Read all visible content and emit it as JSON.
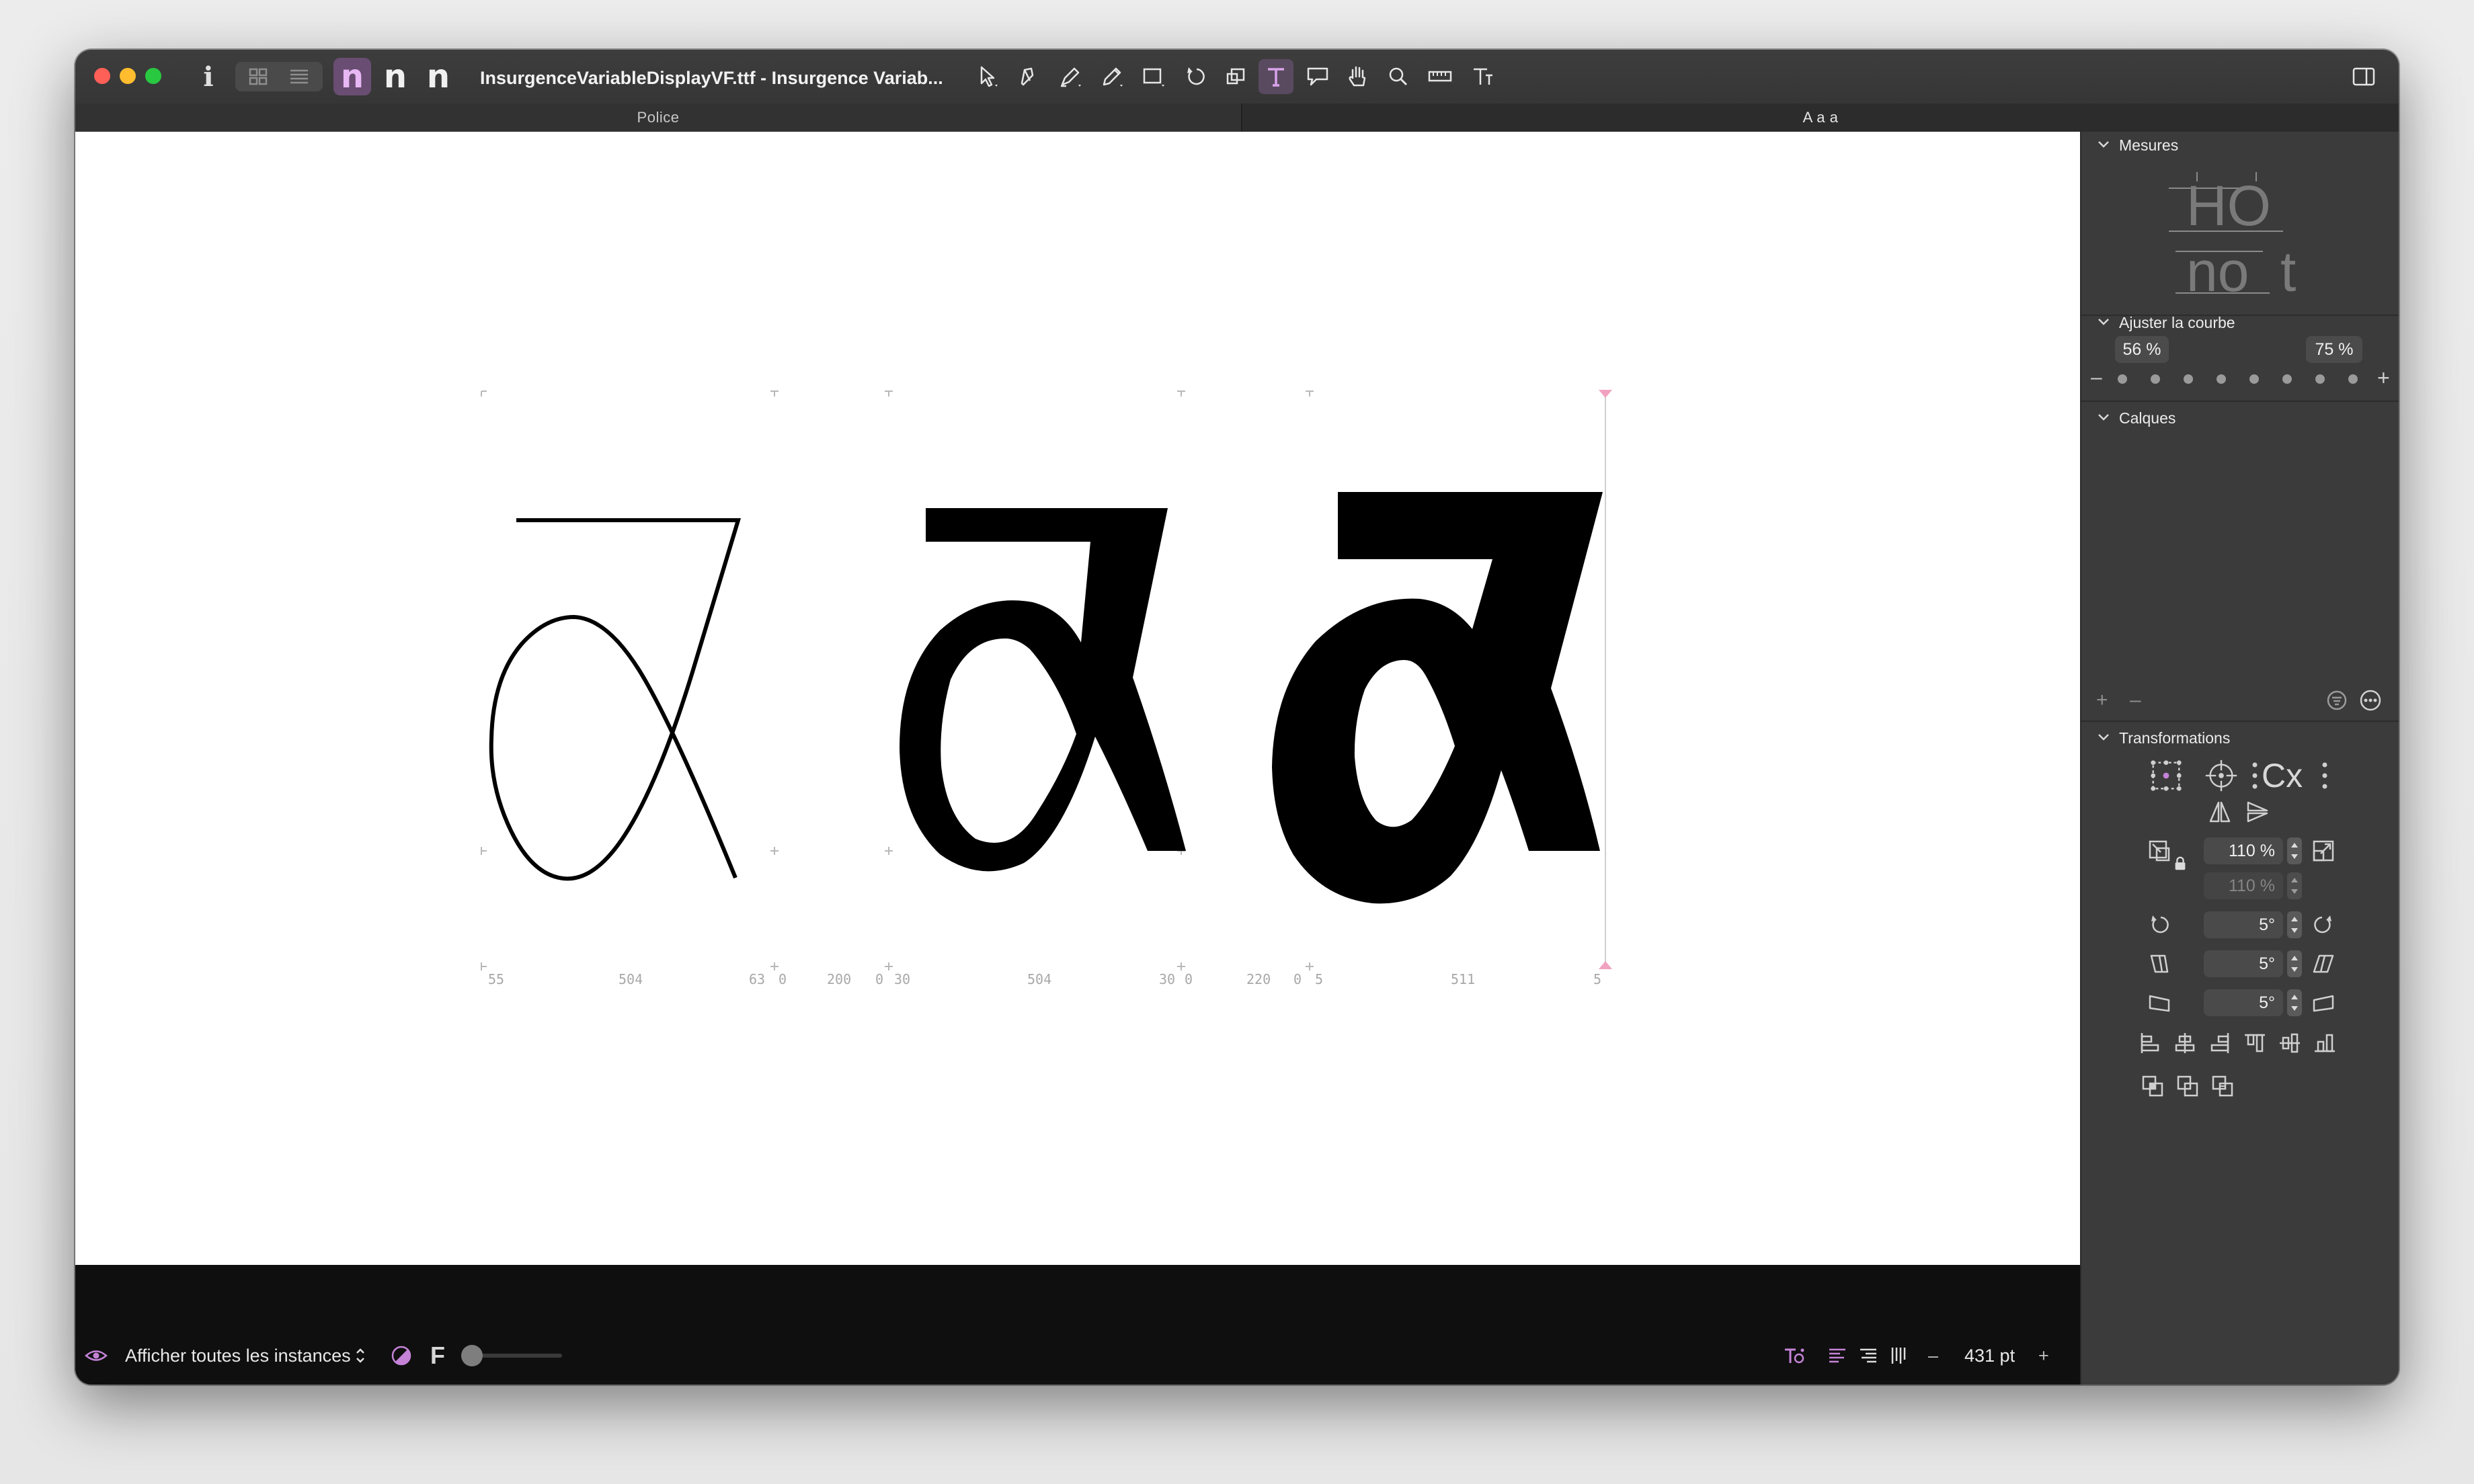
{
  "window": {
    "title": "InsurgenceVariableDisplayVF.ttf - Insurgence Variab...",
    "glyph_tabs": [
      "n",
      "n",
      "n"
    ]
  },
  "tabs": {
    "left": "Police",
    "right": "A a a"
  },
  "canvas": {
    "metrics": [
      "55",
      "504",
      "63",
      "0",
      "200",
      "0",
      "30",
      "504",
      "30",
      "0",
      "220",
      "0",
      "5",
      "511",
      "5"
    ],
    "glyph_char": "α"
  },
  "statusbar": {
    "instances_label": "Afficher toutes les instances",
    "font_glyph": "F",
    "zoom": "431 pt",
    "zoom_minus": "–",
    "zoom_plus": "+"
  },
  "sidebar": {
    "mesures": {
      "title": "Mesures",
      "line1": "HO",
      "line2": "no",
      "line3": "t"
    },
    "ajuster": {
      "title": "Ajuster la courbe",
      "left_value": "56 %",
      "right_value": "75 %",
      "minus": "–",
      "plus": "+"
    },
    "calques": {
      "title": "Calques",
      "add": "+",
      "remove": "–"
    },
    "transformations": {
      "title": "Transformations",
      "origin_label": "Cx",
      "scale_x": "110 %",
      "scale_y": "110 %",
      "rotate": "5°",
      "slant": "5°",
      "skew": "5°"
    }
  },
  "colors": {
    "accent": "#c583d8",
    "canvas_bg": "#ffffff",
    "chrome_bg": "#3b3b3b"
  }
}
